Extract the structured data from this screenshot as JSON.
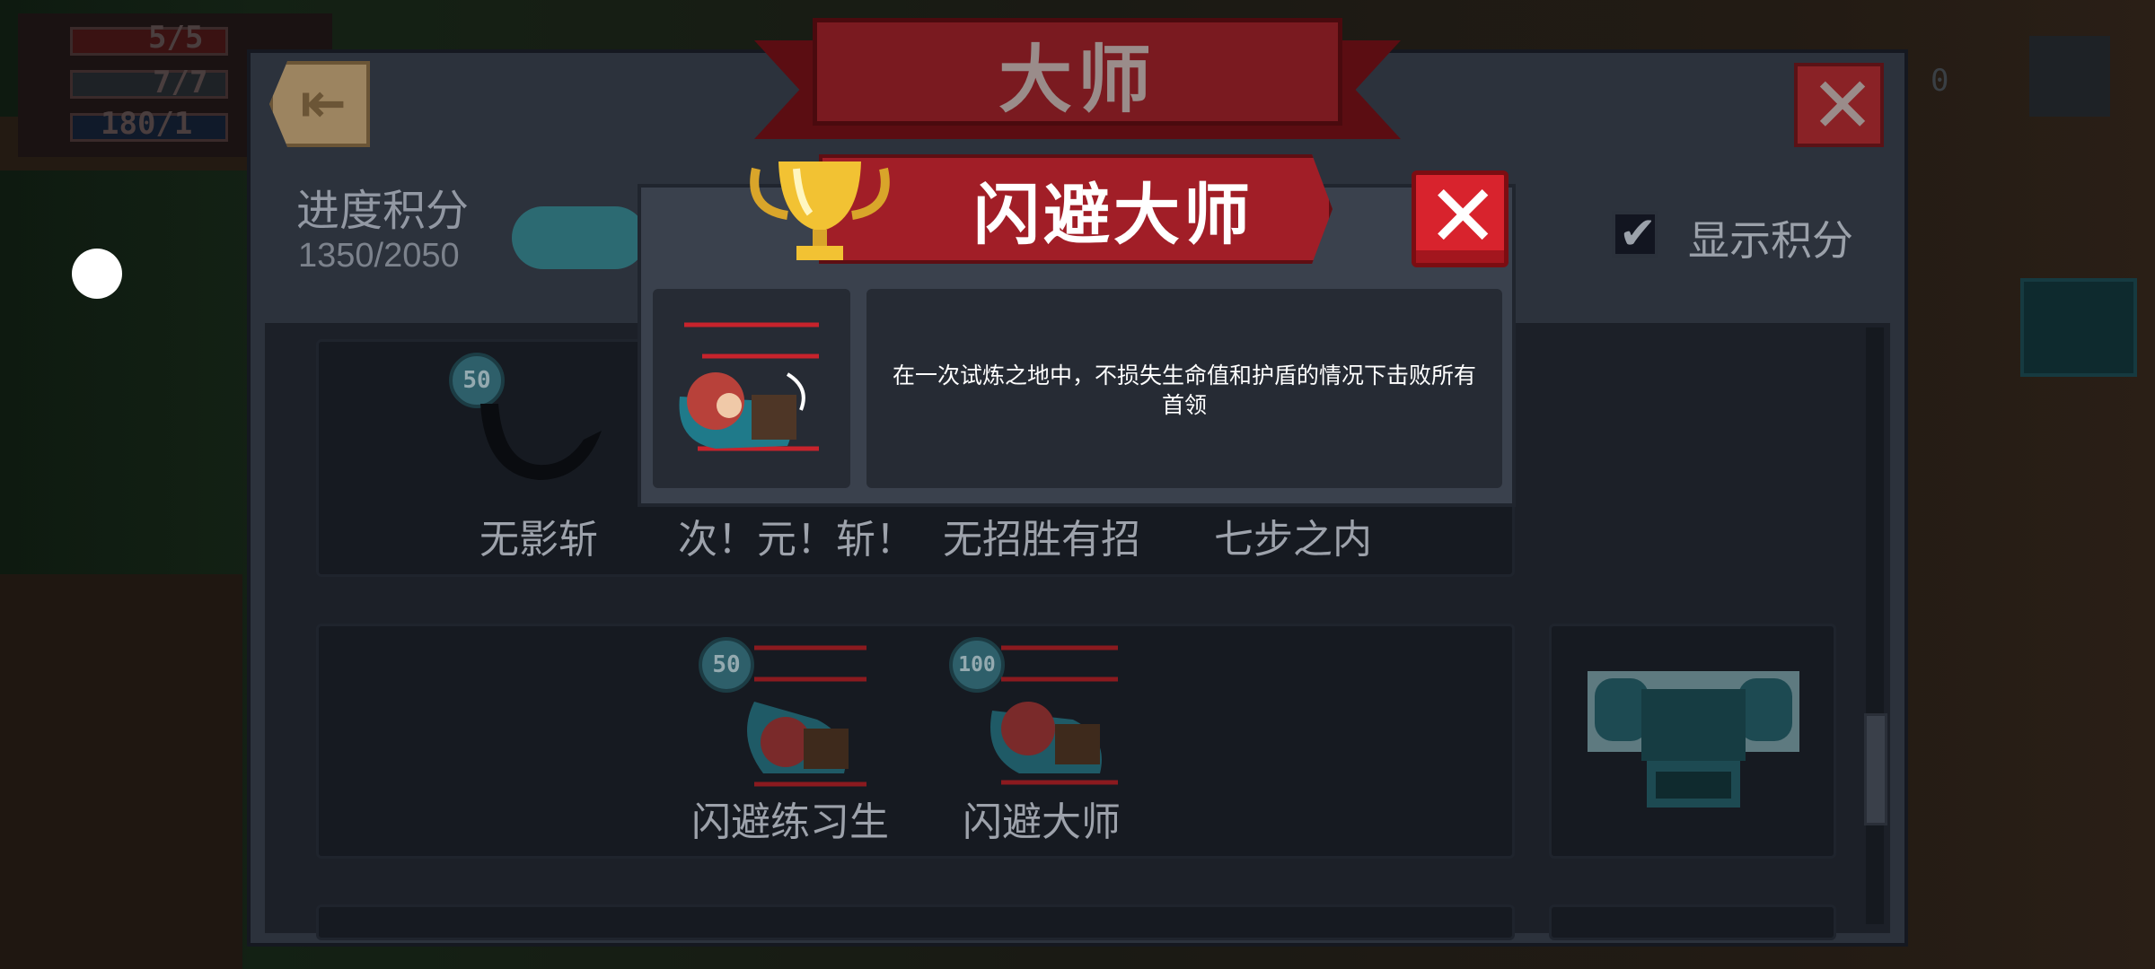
{
  "hud": {
    "hp": "5/5",
    "armor": "7/7",
    "energy": "180/1",
    "version_hint": "0"
  },
  "panel": {
    "title": "大师",
    "progress_label": "进度积分",
    "progress_value": "1350/2050",
    "show_points_label": "显示积分",
    "show_points_checked": true
  },
  "rows": [
    {
      "items": [
        {
          "name": "无影斩",
          "points": "50"
        },
        {
          "name": "次！元！斩！"
        },
        {
          "name": "无招胜有招"
        },
        {
          "name": "七步之内"
        }
      ]
    },
    {
      "items": [
        {
          "name": "闪避练习生",
          "points": "50"
        },
        {
          "name": "闪避大师",
          "points": "100"
        }
      ]
    }
  ],
  "popup": {
    "title": "闪避大师",
    "description": "在一次试炼之地中，不损失生命值和护盾的情况下击败所有首领"
  },
  "colors": {
    "popup_close": "#d8232d",
    "ribbon": "#a11e27",
    "badge": "#2e5f6a"
  }
}
